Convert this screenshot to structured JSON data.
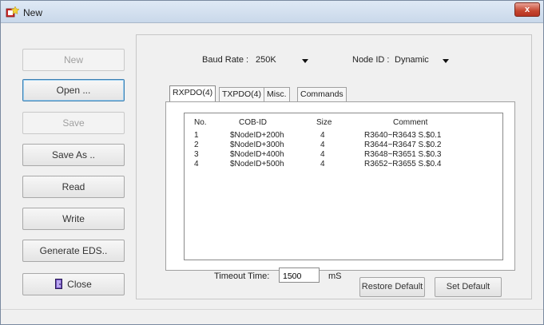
{
  "window": {
    "title": "New",
    "close_glyph": "x",
    "icon": "app-icon"
  },
  "left_buttons": [
    {
      "label": "New",
      "state": "disabled"
    },
    {
      "label": "Open ...",
      "state": "focused"
    },
    {
      "label": "Save",
      "state": "disabled"
    },
    {
      "label": "Save As ..",
      "state": "normal"
    },
    {
      "label": "Read",
      "state": "normal"
    },
    {
      "label": "Write",
      "state": "normal"
    },
    {
      "label": "Generate EDS..",
      "state": "normal"
    },
    {
      "label": "Close",
      "state": "normal",
      "icon": "door-icon"
    }
  ],
  "settings": {
    "baud_rate_label": "Baud Rate :",
    "baud_rate_value": "250K",
    "node_id_label": "Node ID :",
    "node_id_value": "Dynamic"
  },
  "tabs": [
    {
      "label": "RXPDO(4)",
      "active": true
    },
    {
      "label": "TXPDO(4)",
      "active": false
    },
    {
      "label": "Misc.",
      "active": false
    },
    {
      "label": "Commands",
      "active": false
    }
  ],
  "table": {
    "columns": [
      "No.",
      "COB-ID",
      "Size",
      "Comment"
    ],
    "rows": [
      [
        "1",
        "$NodeID+200h",
        "4",
        "R3640~R3643 S.$0.1"
      ],
      [
        "2",
        "$NodeID+300h",
        "4",
        "R3644~R3647 S.$0.2"
      ],
      [
        "3",
        "$NodeID+400h",
        "4",
        "R3648~R3651 S.$0.3"
      ],
      [
        "4",
        "$NodeID+500h",
        "4",
        "R3652~R3655 S.$0.4"
      ]
    ]
  },
  "timeout": {
    "label": "Timeout Time:",
    "value": "1500",
    "unit": "mS"
  },
  "buttons": {
    "restore_default": "Restore Default",
    "set_default": "Set Default"
  },
  "colors": {
    "titlebar": "#c9d8ea",
    "close": "#c5462f",
    "focus": "#3c7fb1"
  }
}
